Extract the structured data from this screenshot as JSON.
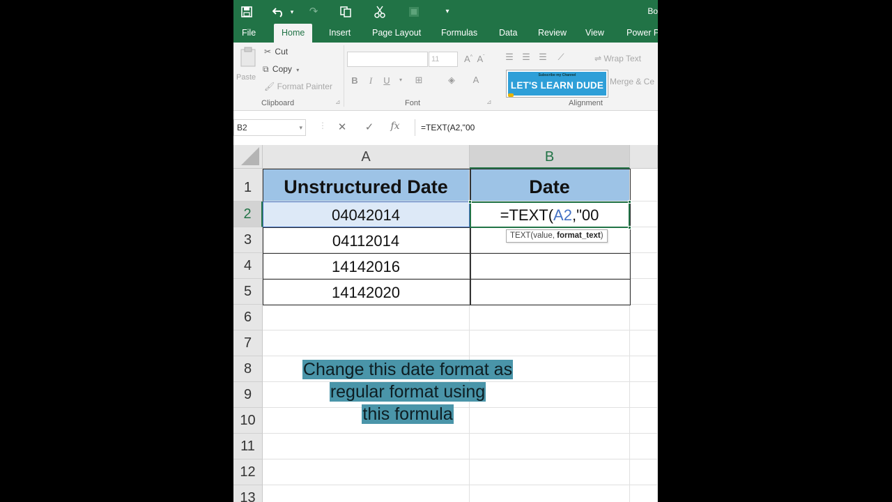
{
  "title_bar": {
    "title": "Bo",
    "icons": [
      "save-icon",
      "undo-icon",
      "redo-icon",
      "copy-icon",
      "cut-icon",
      "format-icon",
      "customize-icon"
    ]
  },
  "tabs": [
    {
      "label": "File",
      "active": false
    },
    {
      "label": "Home",
      "active": true
    },
    {
      "label": "Insert",
      "active": false
    },
    {
      "label": "Page Layout",
      "active": false
    },
    {
      "label": "Formulas",
      "active": false
    },
    {
      "label": "Data",
      "active": false
    },
    {
      "label": "Review",
      "active": false
    },
    {
      "label": "View",
      "active": false
    },
    {
      "label": "Power P",
      "active": false
    }
  ],
  "ribbon": {
    "clipboard": {
      "paste_label": "Paste",
      "cut_label": "Cut",
      "copy_label": "Copy",
      "format_painter_label": "Format Painter",
      "group_label": "Clipboard"
    },
    "font": {
      "font_name": "",
      "font_size": "11",
      "group_label": "Font"
    },
    "alignment": {
      "wrap_text_label": "Wrap Text",
      "merge_label": "Merge & Ce",
      "group_label": "Alignment"
    },
    "brand": {
      "small_text": "Subscribe my Channel",
      "main_text": "LET'S LEARN DUDE"
    }
  },
  "formula_bar": {
    "name_box": "B2",
    "formula": "=TEXT(A2,\"00"
  },
  "grid": {
    "columns": [
      "A",
      "B"
    ],
    "selected_column": "B",
    "selected_row": 2,
    "rows": [
      "1",
      "2",
      "3",
      "4",
      "5",
      "6",
      "7",
      "8",
      "9",
      "10",
      "11",
      "12",
      "13"
    ],
    "header": {
      "a": "Unstructured Date",
      "b": "Date"
    },
    "values": [
      "04042014",
      "04112014",
      "14142016",
      "14142020"
    ],
    "editing_cell": {
      "prefix": "=TEXT(",
      "ref": "A2",
      "suffix": ",\"00"
    },
    "tooltip": {
      "func": "TEXT(value, ",
      "bold_arg": "format_text",
      "close": ")"
    }
  },
  "caption": {
    "lines": [
      "Change this date format as",
      "regular format using",
      "this formula"
    ]
  },
  "colors": {
    "excel_green": "#217346",
    "header_fill": "#9dc3e6",
    "caption_bg": "#4a95a9",
    "reference_blue": "#4472c4"
  }
}
